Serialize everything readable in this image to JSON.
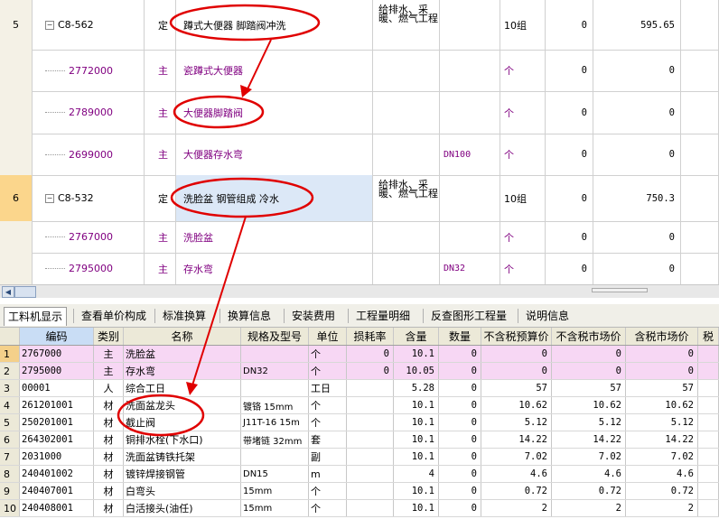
{
  "upper_rows": [
    {
      "type": "main",
      "rownum": "5",
      "code": "C8-562",
      "kind": "定",
      "desc": "蹲式大便器 脚踏阀冲洗",
      "spec": "",
      "major": "给排水、采暖、燃气工程",
      "unit": "10组",
      "qty": "0",
      "price": "595.65"
    },
    {
      "type": "sub",
      "rownum": "",
      "code": "2772000",
      "kind": "主",
      "desc": "瓷蹲式大便器",
      "spec": "",
      "major": "",
      "unit": "个",
      "qty": "0",
      "price": "0"
    },
    {
      "type": "sub",
      "rownum": "",
      "code": "2789000",
      "kind": "主",
      "desc": "大便器脚踏阀",
      "spec": "",
      "major": "",
      "unit": "个",
      "qty": "0",
      "price": "0"
    },
    {
      "type": "sub",
      "rownum": "",
      "code": "2699000",
      "kind": "主",
      "desc": "大便器存水弯",
      "spec": "DN100",
      "major": "",
      "unit": "个",
      "qty": "0",
      "price": "0"
    },
    {
      "type": "main",
      "rownum": "6",
      "code": "C8-532",
      "kind": "定",
      "desc": "洗脸盆 钢管组成 冷水",
      "spec": "",
      "major": "给排水、采暖、燃气工程",
      "unit": "10组",
      "qty": "0",
      "price": "750.3"
    },
    {
      "type": "sub",
      "rownum": "",
      "code": "2767000",
      "kind": "主",
      "desc": "洗脸盆",
      "spec": "",
      "major": "",
      "unit": "个",
      "qty": "0",
      "price": "0"
    },
    {
      "type": "sub",
      "rownum": "",
      "code": "2795000",
      "kind": "主",
      "desc": "存水弯",
      "spec": "DN32",
      "major": "",
      "unit": "个",
      "qty": "0",
      "price": "0"
    }
  ],
  "tabs": [
    "工料机显示",
    "查看单价构成",
    "标准换算",
    "换算信息",
    "安装费用",
    "工程量明细",
    "反查图形工程量",
    "说明信息"
  ],
  "active_tab": 0,
  "lower_headers": [
    "编码",
    "类别",
    "名称",
    "规格及型号",
    "单位",
    "损耗率",
    "含量",
    "数量",
    "不含税预算价",
    "不含税市场价",
    "含税市场价",
    "税"
  ],
  "lower_rows": [
    {
      "idx": "1",
      "code": "2767000",
      "type": "主",
      "name": "洗脸盆",
      "spec": "",
      "unit": "个",
      "loss": "0",
      "content": "10.1",
      "qty": "0",
      "p1": "0",
      "p2": "0",
      "p3": "0",
      "pink": true
    },
    {
      "idx": "2",
      "code": "2795000",
      "type": "主",
      "name": "存水弯",
      "spec": "DN32",
      "unit": "个",
      "loss": "0",
      "content": "10.05",
      "qty": "0",
      "p1": "0",
      "p2": "0",
      "p3": "0",
      "pink": true
    },
    {
      "idx": "3",
      "code": "00001",
      "type": "人",
      "name": "综合工日",
      "spec": "",
      "unit": "工日",
      "loss": "",
      "content": "5.28",
      "qty": "0",
      "p1": "57",
      "p2": "57",
      "p3": "57",
      "pink": false
    },
    {
      "idx": "4",
      "code": "261201001",
      "type": "材",
      "name": "洗面盆龙头",
      "spec": "镀铬 15mm",
      "unit": "个",
      "loss": "",
      "content": "10.1",
      "qty": "0",
      "p1": "10.62",
      "p2": "10.62",
      "p3": "10.62",
      "pink": false
    },
    {
      "idx": "5",
      "code": "250201001",
      "type": "材",
      "name": "截止阀",
      "spec": "J11T-16 15m",
      "unit": "个",
      "loss": "",
      "content": "10.1",
      "qty": "0",
      "p1": "5.12",
      "p2": "5.12",
      "p3": "5.12",
      "pink": false
    },
    {
      "idx": "6",
      "code": "264302001",
      "type": "材",
      "name": "铜排水栓(下水口)",
      "spec": "带堵链 32mm",
      "unit": "套",
      "loss": "",
      "content": "10.1",
      "qty": "0",
      "p1": "14.22",
      "p2": "14.22",
      "p3": "14.22",
      "pink": false
    },
    {
      "idx": "7",
      "code": "2031000",
      "type": "材",
      "name": "洗面盆铸铁托架",
      "spec": "",
      "unit": "副",
      "loss": "",
      "content": "10.1",
      "qty": "0",
      "p1": "7.02",
      "p2": "7.02",
      "p3": "7.02",
      "pink": false
    },
    {
      "idx": "8",
      "code": "240401002",
      "type": "材",
      "name": "镀锌焊接钢管",
      "spec": "DN15",
      "unit": "m",
      "loss": "",
      "content": "4",
      "qty": "0",
      "p1": "4.6",
      "p2": "4.6",
      "p3": "4.6",
      "pink": false
    },
    {
      "idx": "9",
      "code": "240407001",
      "type": "材",
      "name": "白弯头",
      "spec": "15mm",
      "unit": "个",
      "loss": "",
      "content": "10.1",
      "qty": "0",
      "p1": "0.72",
      "p2": "0.72",
      "p3": "0.72",
      "pink": false
    },
    {
      "idx": "10",
      "code": "240408001",
      "type": "材",
      "name": "白活接头(油任)",
      "spec": "15mm",
      "unit": "个",
      "loss": "",
      "content": "10.1",
      "qty": "0",
      "p1": "2",
      "p2": "2",
      "p3": "2",
      "pink": false
    }
  ],
  "colors": {
    "annotation": "#e00000",
    "purple": "#800080",
    "selected_rownum": "#fbd68c",
    "pink_row": "#f7d7f4",
    "desc_highlight": "#dce8f7"
  }
}
